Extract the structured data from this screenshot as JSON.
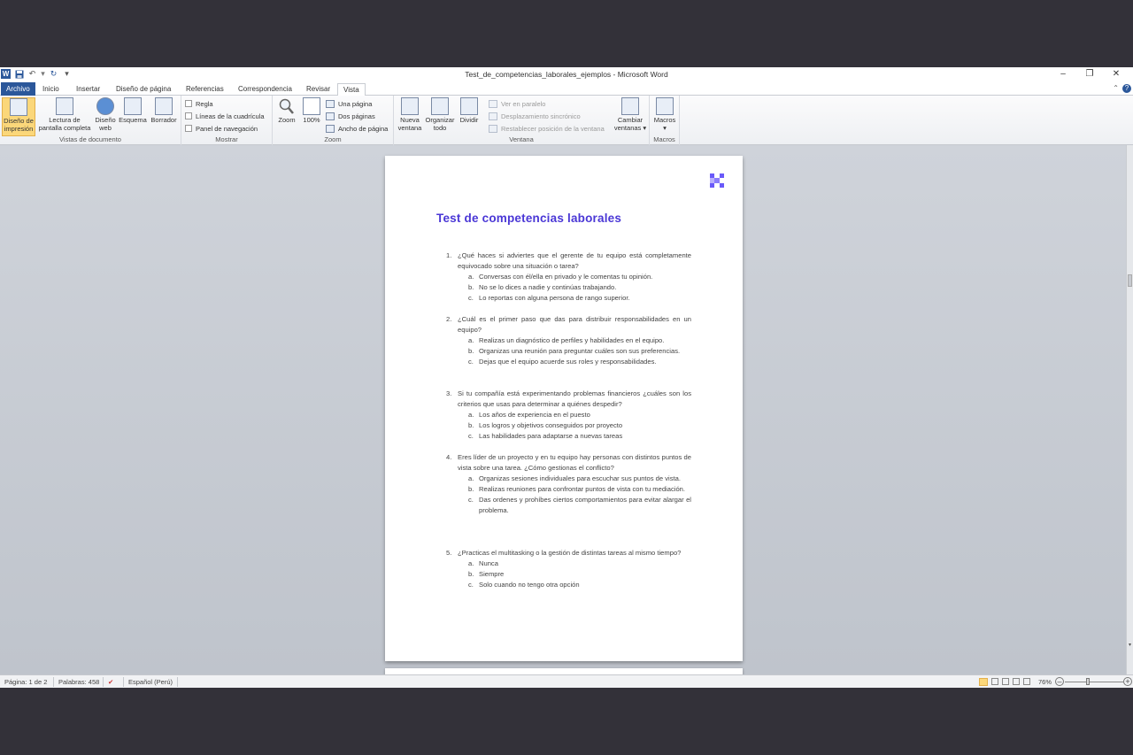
{
  "window": {
    "title": "Test_de_competencias_laborales_ejemplos - Microsoft Word"
  },
  "tabs": {
    "file": "Archivo",
    "items": [
      "Inicio",
      "Insertar",
      "Diseño de página",
      "Referencias",
      "Correspondencia",
      "Revisar",
      "Vista"
    ],
    "active": "Vista"
  },
  "ribbon": {
    "vistas": {
      "label": "Vistas de documento",
      "diseno_impresion": "Diseño de impresión",
      "lectura_l1": "Lectura de",
      "lectura_l2": "pantalla completa",
      "diseno_web_l1": "Diseño",
      "diseno_web_l2": "web",
      "esquema": "Esquema",
      "borrador": "Borrador"
    },
    "mostrar": {
      "label": "Mostrar",
      "regla": "Regla",
      "cuadricula": "Líneas de la cuadrícula",
      "navegacion": "Panel de navegación"
    },
    "zoom": {
      "label": "Zoom",
      "zoom": "Zoom",
      "cien": "100%",
      "una_pagina": "Una página",
      "dos_paginas": "Dos páginas",
      "ancho": "Ancho de página"
    },
    "ventana": {
      "label": "Ventana",
      "nueva_l1": "Nueva",
      "nueva_l2": "ventana",
      "organizar_l1": "Organizar",
      "organizar_l2": "todo",
      "dividir": "Dividir",
      "paralelo": "Ver en paralelo",
      "desplazamiento": "Desplazamiento sincrónico",
      "restablecer": "Restablecer posición de la ventana",
      "cambiar_l1": "Cambiar",
      "cambiar_l2": "ventanas ▾"
    },
    "macros": {
      "label": "Macros",
      "macros": "Macros"
    }
  },
  "document": {
    "title": "Test de competencias laborales",
    "questions": [
      {
        "num": "1.",
        "text": "¿Qué haces si adviertes que el gerente de tu equipo está completamente equivocado sobre una situación o tarea?",
        "options": [
          {
            "l": "a.",
            "t": "Conversas con él/ella en privado y le comentas tu opinión."
          },
          {
            "l": "b.",
            "t": "No se lo dices a nadie y continúas trabajando."
          },
          {
            "l": "c.",
            "t": "Lo reportas con alguna persona de rango superior."
          }
        ]
      },
      {
        "num": "2.",
        "text": "¿Cuál es el primer paso que das para distribuir responsabilidades en un equipo?",
        "options": [
          {
            "l": "a.",
            "t": "Realizas un diagnóstico de perfiles y habilidades en el equipo."
          },
          {
            "l": "b.",
            "t": "Organizas una reunión para preguntar cuáles son sus preferencias."
          },
          {
            "l": "c.",
            "t": "Dejas que el equipo acuerde sus roles y responsabilidades."
          }
        ]
      },
      {
        "num": "3.",
        "text": "Si tu compañía está experimentando problemas financieros ¿cuáles son los criterios que usas para determinar a quiénes despedir?",
        "options": [
          {
            "l": "a.",
            "t": "Los años de experiencia en el puesto"
          },
          {
            "l": "b.",
            "t": "Los logros y objetivos conseguidos por proyecto"
          },
          {
            "l": "c.",
            "t": "Las habilidades para adaptarse a nuevas tareas"
          }
        ]
      },
      {
        "num": "4.",
        "text": "Eres líder de un proyecto y en tu equipo hay personas con distintos puntos de vista sobre una tarea. ¿Cómo gestionas el conflicto?",
        "options": [
          {
            "l": "a.",
            "t": "Organizas sesiones individuales para escuchar sus puntos de vista."
          },
          {
            "l": "b.",
            "t": "Realizas reuniones para confrontar puntos de vista con tu mediación."
          },
          {
            "l": "c.",
            "t": "Das ordenes y prohíbes ciertos comportamientos para evitar alargar el problema."
          }
        ]
      },
      {
        "num": "5.",
        "text": "¿Practicas el multitasking o la gestión de distintas tareas al mismo tiempo?",
        "options": [
          {
            "l": "a.",
            "t": "Nunca"
          },
          {
            "l": "b.",
            "t": "Siempre"
          },
          {
            "l": "c.",
            "t": "Solo cuando no tengo otra opción"
          }
        ]
      }
    ]
  },
  "status": {
    "page": "Página: 1 de 2",
    "words": "Palabras: 458",
    "language": "Español (Perú)",
    "zoom": "76%"
  },
  "colors": {
    "title_color": "#4a37d6",
    "file_tab": "#2b579a"
  }
}
